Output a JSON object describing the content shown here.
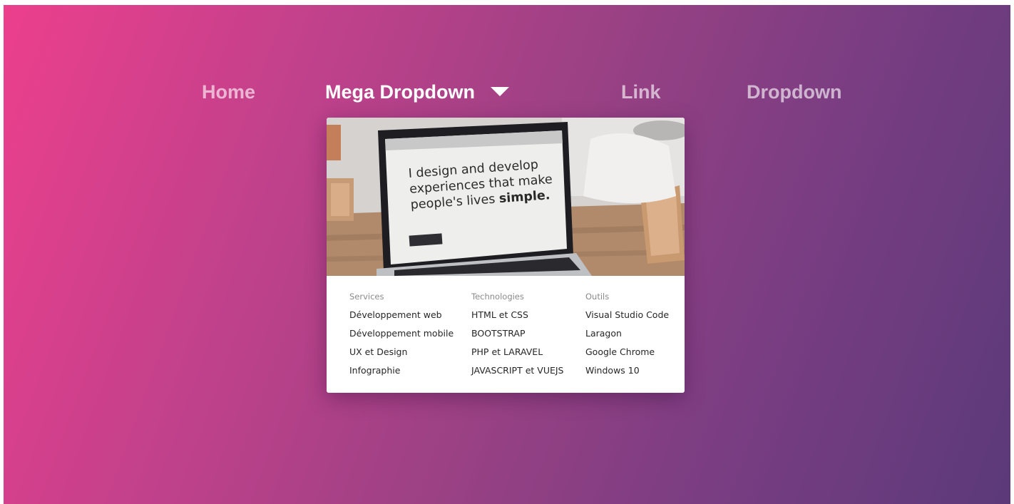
{
  "nav": {
    "home": "Home",
    "mega": "Mega Dropdown",
    "link": "Link",
    "dropdown": "Dropdown"
  },
  "colors": {
    "gradient_start": "#ec3f8c",
    "gradient_end": "#5b3a7a",
    "panel_bg": "#ffffff",
    "heading_text": "#8a8a8a",
    "item_text": "#262626"
  },
  "icons": {
    "caret": "caret-down-icon"
  },
  "hero": {
    "line1": "I design and develop",
    "line2": "experiences that make",
    "line3": "people's lives",
    "line3_bold": "simple."
  },
  "columns": [
    {
      "title": "Services",
      "items": [
        "Développement web",
        "Développement mobile",
        "UX et Design",
        "Infographie"
      ]
    },
    {
      "title": "Technologies",
      "items": [
        "HTML et CSS",
        "BOOTSTRAP",
        "PHP et LARAVEL",
        "JAVASCRIPT et VUEJS"
      ]
    },
    {
      "title": "Outils",
      "items": [
        "Visual Studio Code",
        "Laragon",
        "Google Chrome",
        "Windows 10"
      ]
    }
  ]
}
